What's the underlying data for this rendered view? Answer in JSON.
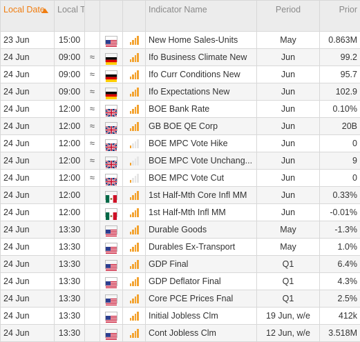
{
  "header": {
    "date": "Local Date",
    "time": "Local Time",
    "indicator": "Indicator Name",
    "period": "Period",
    "prior": "Prior"
  },
  "colors": {
    "accent": "#f07d10",
    "importance": "#f3a22e",
    "header_bg": "#ececec"
  },
  "rows": [
    {
      "date": "23 Jun",
      "time": "15:00",
      "vol": "",
      "flag": "us",
      "importance": 4,
      "name": "New Home Sales-Units",
      "period": "May",
      "prior": "0.863M"
    },
    {
      "date": "24 Jun",
      "time": "09:00",
      "vol": "≈",
      "flag": "de",
      "importance": 4,
      "name": "Ifo Business Climate New",
      "period": "Jun",
      "prior": "99.2"
    },
    {
      "date": "24 Jun",
      "time": "09:00",
      "vol": "≈",
      "flag": "de",
      "importance": 4,
      "name": "Ifo Curr Conditions New",
      "period": "Jun",
      "prior": "95.7"
    },
    {
      "date": "24 Jun",
      "time": "09:00",
      "vol": "≈",
      "flag": "de",
      "importance": 4,
      "name": "Ifo Expectations New",
      "period": "Jun",
      "prior": "102.9"
    },
    {
      "date": "24 Jun",
      "time": "12:00",
      "vol": "≈",
      "flag": "gb",
      "importance": 4,
      "name": "BOE Bank Rate",
      "period": "Jun",
      "prior": "0.10%"
    },
    {
      "date": "24 Jun",
      "time": "12:00",
      "vol": "≈",
      "flag": "gb",
      "importance": 4,
      "name": "GB BOE QE Corp",
      "period": "Jun",
      "prior": "20B"
    },
    {
      "date": "24 Jun",
      "time": "12:00",
      "vol": "≈",
      "flag": "gb",
      "importance": 1,
      "name": "BOE MPC Vote Hike",
      "period": "Jun",
      "prior": "0"
    },
    {
      "date": "24 Jun",
      "time": "12:00",
      "vol": "≈",
      "flag": "gb",
      "importance": 1,
      "name": "BOE MPC Vote Unchang...",
      "period": "Jun",
      "prior": "9"
    },
    {
      "date": "24 Jun",
      "time": "12:00",
      "vol": "≈",
      "flag": "gb",
      "importance": 1,
      "name": "BOE MPC Vote Cut",
      "period": "Jun",
      "prior": "0"
    },
    {
      "date": "24 Jun",
      "time": "12:00",
      "vol": "",
      "flag": "mx",
      "importance": 4,
      "name": "1st Half-Mth Core Infl MM",
      "period": "Jun",
      "prior": "0.33%"
    },
    {
      "date": "24 Jun",
      "time": "12:00",
      "vol": "",
      "flag": "mx",
      "importance": 4,
      "name": "1st Half-Mth Infl MM",
      "period": "Jun",
      "prior": "-0.01%"
    },
    {
      "date": "24 Jun",
      "time": "13:30",
      "vol": "",
      "flag": "us",
      "importance": 4,
      "name": "Durable Goods",
      "period": "May",
      "prior": "-1.3%"
    },
    {
      "date": "24 Jun",
      "time": "13:30",
      "vol": "",
      "flag": "us",
      "importance": 4,
      "name": "Durables Ex-Transport",
      "period": "May",
      "prior": "1.0%"
    },
    {
      "date": "24 Jun",
      "time": "13:30",
      "vol": "",
      "flag": "us",
      "importance": 4,
      "name": "GDP Final",
      "period": "Q1",
      "prior": "6.4%"
    },
    {
      "date": "24 Jun",
      "time": "13:30",
      "vol": "",
      "flag": "us",
      "importance": 4,
      "name": "GDP Deflator Final",
      "period": "Q1",
      "prior": "4.3%"
    },
    {
      "date": "24 Jun",
      "time": "13:30",
      "vol": "",
      "flag": "us",
      "importance": 4,
      "name": "Core PCE Prices Fnal",
      "period": "Q1",
      "prior": "2.5%"
    },
    {
      "date": "24 Jun",
      "time": "13:30",
      "vol": "",
      "flag": "us",
      "importance": 4,
      "name": "Initial Jobless Clm",
      "period": "19 Jun, w/e",
      "prior": "412k"
    },
    {
      "date": "24 Jun",
      "time": "13:30",
      "vol": "",
      "flag": "us",
      "importance": 4,
      "name": "Cont Jobless Clm",
      "period": "12 Jun, w/e",
      "prior": "3.518M"
    }
  ]
}
